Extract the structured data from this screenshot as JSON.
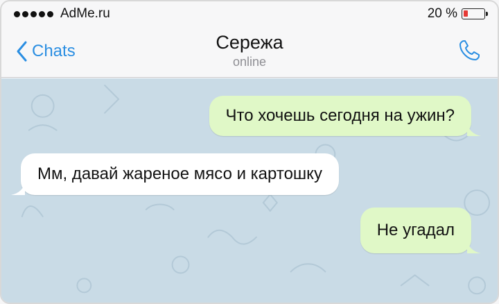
{
  "status_bar": {
    "carrier": "AdMe.ru",
    "battery_percent_label": "20 %",
    "battery_level": 0.2,
    "battery_color": "#e53935"
  },
  "nav": {
    "back_label": "Chats",
    "contact_name": "Сережа",
    "contact_status": "online",
    "accent_color": "#2a8ee2",
    "right_icon": "phone-icon"
  },
  "messages": [
    {
      "direction": "outgoing",
      "text": "Что хочешь сегодня на ужин?"
    },
    {
      "direction": "incoming",
      "text": "Мм, давай жареное мясо и картошку"
    },
    {
      "direction": "outgoing",
      "text": "Не угадал"
    }
  ],
  "colors": {
    "outgoing_bubble": "#e0f8c7",
    "incoming_bubble": "#ffffff",
    "chat_background": "#c9dbe6"
  }
}
